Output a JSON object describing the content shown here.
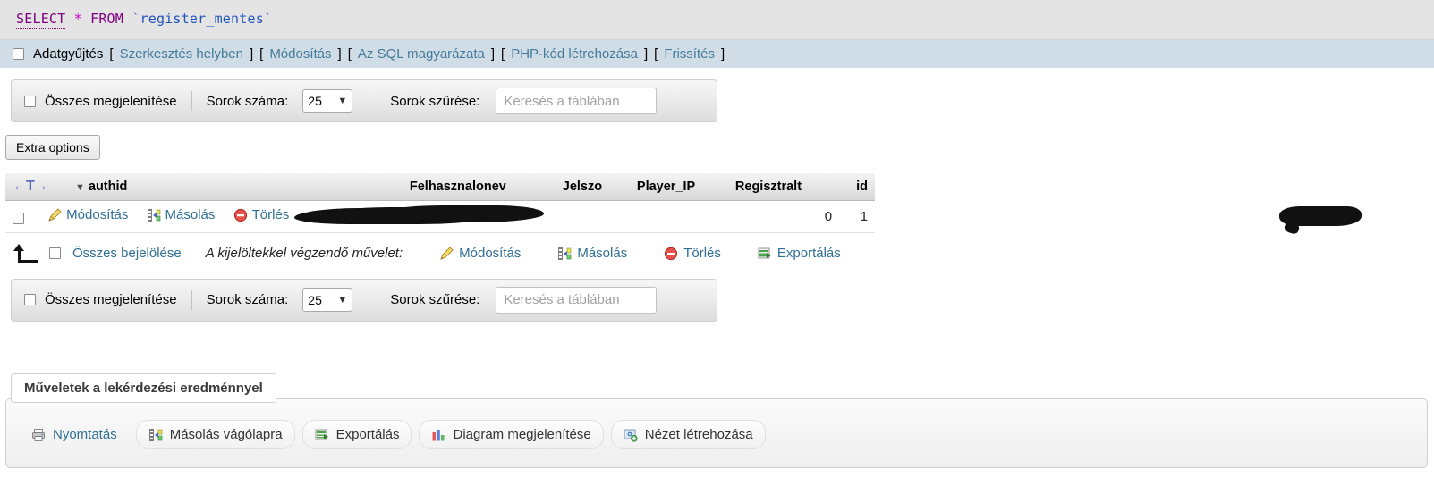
{
  "sql": {
    "keyword_select": "SELECT",
    "star": "*",
    "keyword_from": "FROM",
    "table_ref": "`register_mentes`"
  },
  "action_bar": {
    "label": "Adatgyűjtés",
    "links": [
      "Szerkesztés helyben",
      "Módosítás",
      "Az SQL magyarázata",
      "PHP-kód létrehozása",
      "Frissítés"
    ],
    "open_bracket": "[",
    "close_bracket": "]"
  },
  "rows_panel": {
    "show_all_label": "Összes megjelenítése",
    "rows_number_label": "Sorok száma:",
    "rows_number_value": "25",
    "filter_label": "Sorok szűrése:",
    "filter_placeholder": "Keresés a táblában",
    "chevron": "⌄"
  },
  "extra_options": {
    "label": "Extra options"
  },
  "table": {
    "nav_widget": "←T→",
    "sort_arrow": "▼",
    "columns": [
      "authid",
      "Felhasznalonev",
      "Jelszo",
      "Player_IP",
      "Regisztralt",
      "id"
    ],
    "row_actions": [
      "Módosítás",
      "Másolás",
      "Törlés"
    ],
    "rows": [
      {
        "authid": "",
        "felhasznalonev": "",
        "jelszo": "",
        "player_ip": "",
        "regisztralt": "0",
        "id": "1"
      }
    ]
  },
  "bulk": {
    "check_all_label": "Összes bejelölése",
    "with_selected_label": "A kijelöltekkel végzendő művelet:",
    "actions": [
      "Módosítás",
      "Másolás",
      "Törlés",
      "Exportálás"
    ]
  },
  "bottom": {
    "legend": "Műveletek a lekérdezési eredménnyel",
    "buttons": [
      "Nyomtatás",
      "Másolás vágólapra",
      "Exportálás",
      "Diagram megjelenítése",
      "Nézet létrehozása"
    ]
  },
  "colors": {
    "link": "#2f6f94",
    "action_bar_bg": "#d0dce6",
    "sql_bar_bg": "#e4e4e4",
    "keyword": "#800080",
    "star": "#cc00cc",
    "table_ref": "#2255bb",
    "delete_red": "#d9342b",
    "nav_blue": "#5c6bc0"
  }
}
